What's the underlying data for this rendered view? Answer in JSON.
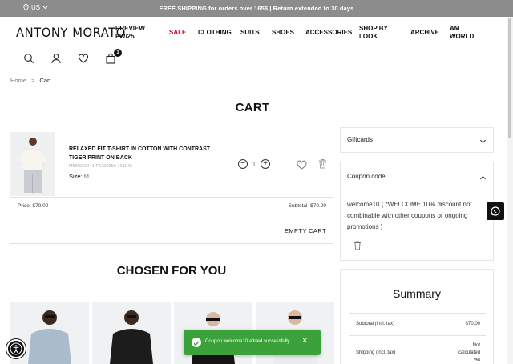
{
  "topbar": {
    "region": "US",
    "promo": "FREE SHIPPING for orders over 165$ | Return extended to 30 days"
  },
  "header": {
    "logo": "ANTONY MORATO",
    "nav": [
      {
        "label": "PREVIEW FW/25"
      },
      {
        "label": "SALE"
      },
      {
        "label": "CLOTHING"
      },
      {
        "label": "SUITS"
      },
      {
        "label": "SHOES"
      },
      {
        "label": "ACCESSORIES"
      },
      {
        "label": "SHOP BY LOOK"
      },
      {
        "label": "ARCHIVE"
      },
      {
        "label": "AM WORLD"
      }
    ],
    "cart_count": "1"
  },
  "breadcrumb": {
    "home": "Home",
    "separator": ">",
    "current": "Cart"
  },
  "page_title": "CART",
  "cart": {
    "item": {
      "name": "RELAXED FIT T-SHIRT IN COTTON WITH CONTRAST TIGER PRINT ON BACK",
      "code": "MMKS02441-FA100250-1011-M",
      "size_label": "Size:",
      "size_value": "M",
      "quantity": "1"
    },
    "price_label": "Price",
    "price_value": "$70.00",
    "subtotal_label": "Subtotal",
    "subtotal_value": "$70.00",
    "empty_cart": "EMPTY CART"
  },
  "chosen_for_you": "CHOSEN FOR YOU",
  "sidebar": {
    "giftcards": "Giftcards",
    "coupon_code": "Coupon code",
    "coupon_applied": "welcome10 ( *WELCOME 10% discount not combinable with other coupons or ongoing promotions )"
  },
  "summary": {
    "title": "Summary",
    "subtotal_label": "Subtotal (incl. tax)",
    "subtotal_value": "$70.00",
    "shipping_label": "Shipping (incl. tax)",
    "shipping_value_1": "Not",
    "shipping_value_2": "calculated",
    "shipping_value_3": "yet"
  },
  "toast": {
    "message": "Coupon welcome10 added successfully"
  },
  "colors": {
    "topbar": "#8c8c8c",
    "sale": "#d0021b",
    "toast": "#3ba13b"
  },
  "icons": [
    "location-icon",
    "chevron-down-icon",
    "search-icon",
    "user-icon",
    "heart-icon",
    "bag-icon",
    "minus-icon",
    "plus-icon",
    "trash-icon",
    "whatsapp-icon",
    "accessibility-icon",
    "check-icon",
    "close-icon"
  ]
}
